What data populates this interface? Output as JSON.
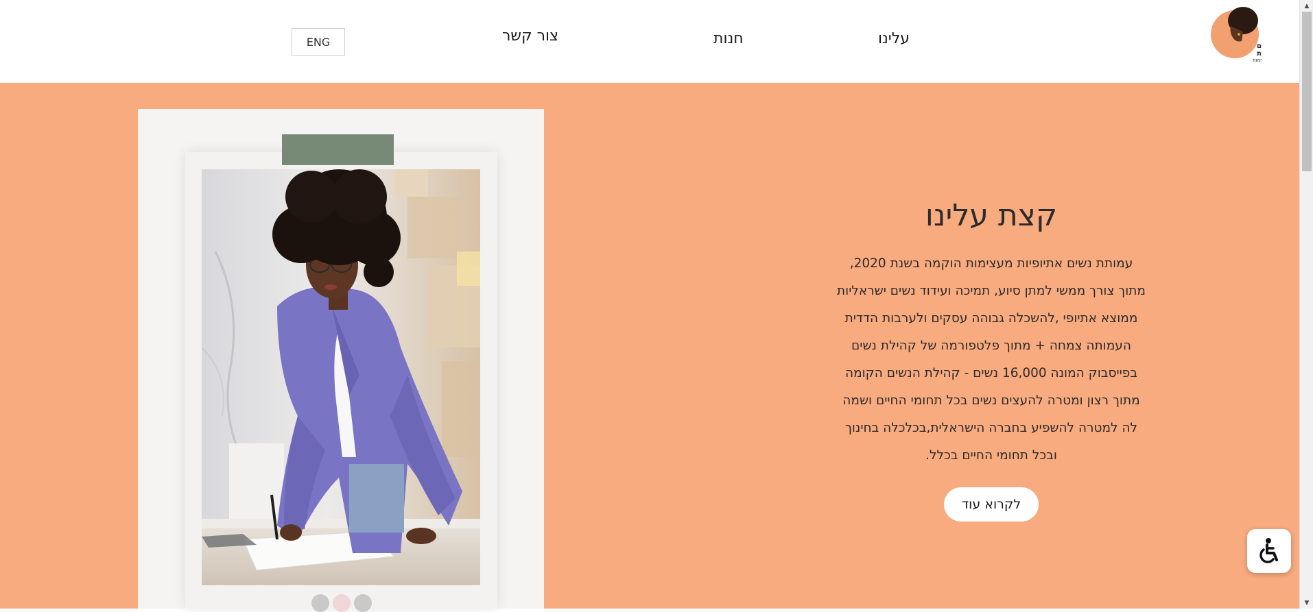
{
  "header": {
    "nav": {
      "about": "עלינו",
      "shop": "חנות",
      "contact": "צור קשר"
    },
    "lang_button": "ENG",
    "logo": {
      "icon": "logo-woman-silhouette",
      "text_line1": "נשים",
      "text_line2": "אתיופיות",
      "text_line3": "מעצימות"
    }
  },
  "about": {
    "title": "קצת עלינו",
    "body": "עמותת נשים אתיופיות מעצימות הוקמה בשנת 2020, מתוך צורך ממשי למתן סיוע, תמיכה ועידוד נשים ישראליות ממוצא אתיופי ,להשכלה גבוהה עסקים ולערבות הדדית העמותה צמחה + מתוך פלטפורמה של קהילת נשים בפייסבוק המונה 16,000 נשים - קהילת הנשים הקומה מתוך רצון ומטרה להעצים נשים בכל תחומי החיים ושמה לה למטרה להשפיע בחברה הישראלית,בכלכלה בחינוך ובכל תחומי החיים בכלל.",
    "read_more": "לקרוא עוד"
  },
  "gallery": {
    "dots_count": 3,
    "active_dot": 2
  },
  "colors": {
    "hero_bg": "#f9ab80",
    "card_bg": "#f6f4f2",
    "tab_green": "#778a76"
  },
  "widgets": {
    "accessibility_icon": "wheelchair-icon"
  }
}
